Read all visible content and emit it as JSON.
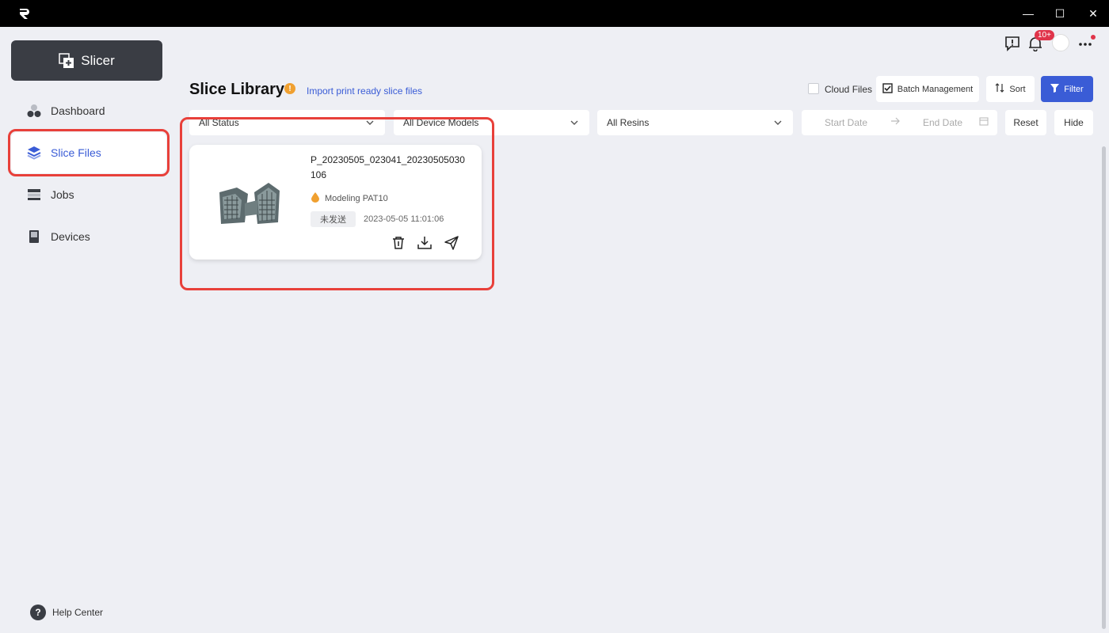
{
  "window": {
    "controls": {
      "minimize": "—",
      "maximize": "☐",
      "close": "✕"
    }
  },
  "sidebar": {
    "brand_label": "Slicer",
    "items": [
      {
        "label": "Dashboard",
        "icon": "dashboard-icon"
      },
      {
        "label": "Slice Files",
        "icon": "layers-icon",
        "active": true
      },
      {
        "label": "Jobs",
        "icon": "jobs-icon"
      },
      {
        "label": "Devices",
        "icon": "device-icon"
      }
    ],
    "help_label": "Help Center"
  },
  "topbar": {
    "notification_badge": "10+"
  },
  "header": {
    "title": "Slice Library",
    "import_link": "Import print ready slice files",
    "cloud_files_label": "Cloud Files",
    "batch_label": "Batch Management",
    "sort_label": "Sort",
    "filter_label": "Filter"
  },
  "filters": {
    "status": "All Status",
    "device_models": "All Device Models",
    "resins": "All Resins",
    "start_date_placeholder": "Start Date",
    "end_date_placeholder": "End Date",
    "reset_label": "Reset",
    "hide_label": "Hide"
  },
  "files": [
    {
      "name": "P_20230505_023041_20230505030106",
      "resin": "Modeling PAT10",
      "status": "未发送",
      "date": "2023-05-05 11:01:06"
    }
  ],
  "colors": {
    "accent": "#3a5cd6",
    "annotation": "#e8403a",
    "sidebar_brand": "#3a3d44"
  }
}
